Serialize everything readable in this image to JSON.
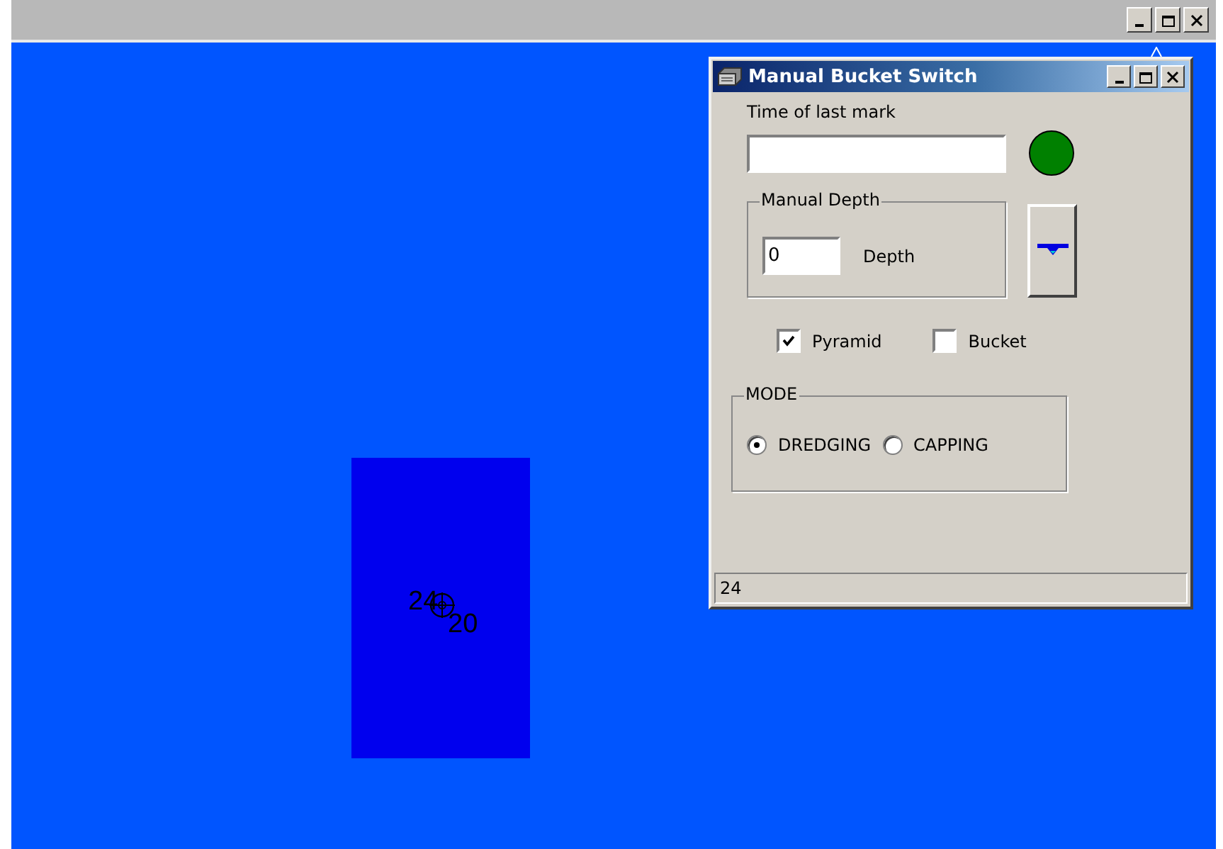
{
  "main_window": {
    "canvas": {
      "labels": [
        {
          "text": "24"
        },
        {
          "text": "20"
        }
      ]
    }
  },
  "dialog": {
    "title": "Manual Bucket Switch",
    "time_of_last_mark": {
      "label": "Time of last mark",
      "indicator_on": true
    },
    "manual_depth": {
      "legend": "Manual Depth",
      "value": "0",
      "label": "Depth"
    },
    "checkboxes": [
      {
        "label": "Pyramid",
        "checked": true
      },
      {
        "label": "Bucket",
        "checked": false
      }
    ],
    "mode": {
      "legend": "MODE",
      "options": [
        {
          "label": "DREDGING",
          "selected": true
        },
        {
          "label": "CAPPING",
          "selected": false
        }
      ]
    },
    "status_bar": "24"
  }
}
